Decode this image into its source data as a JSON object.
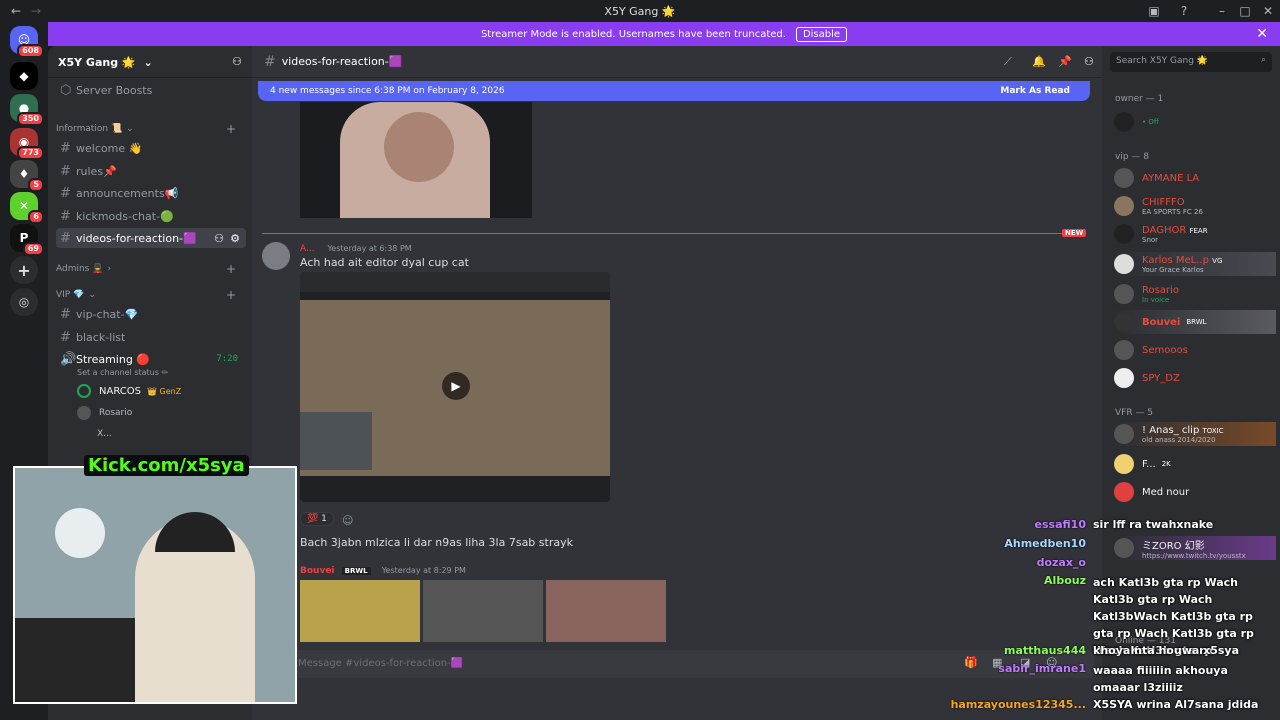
{
  "window": {
    "title": "X5Y Gang 🌟"
  },
  "banner": {
    "text": "Streamer Mode is enabled. Usernames have been truncated.",
    "disable_label": "Disable"
  },
  "rail": {
    "badges": [
      "608",
      "350",
      "773",
      "5",
      "6",
      "69"
    ]
  },
  "guild": {
    "name": "X5Y Gang 🌟",
    "server_boosts": "Server Boosts"
  },
  "sidebar": {
    "categories": {
      "information": "Information 📜",
      "admins": "Admins 💂",
      "vip": "VIP 💎"
    },
    "channels": {
      "welcome": "welcome 👋",
      "rules": "rules📌",
      "announcements": "announcements📢",
      "kickmods": "kickmods-chat-🟢",
      "videos": "videos-for-reaction-🟪",
      "vipchat": "vip-chat-💎",
      "blacklist": "black-list",
      "streaming": "Streaming 🔴"
    },
    "streaming_time": "7:20",
    "channel_status": "Set a channel status ✏",
    "voice_users": [
      "NARCOS",
      "Rosario",
      "X..."
    ],
    "voice_tag": "GenZ"
  },
  "main": {
    "channel_name": "videos-for-reaction-🟪",
    "new_messages": "4 new messages since 6:38 PM on February 8, 2026",
    "mark_as_read": "Mark As Read",
    "new_label": "NEW",
    "msg1": {
      "author": "A...",
      "time": "Yesterday at 6:38 PM",
      "text": "Ach had ait editor dyal cup cat"
    },
    "reaction_count": "1",
    "msg2_text": "Bach 3jabn mlzica li dar n9as liha 3la 7sab strayk",
    "msg3": {
      "author": "Bouvei",
      "tag": "BRWL",
      "time": "Yesterday at 8:29 PM"
    },
    "composer_placeholder": "Message #videos-for-reaction-🟪"
  },
  "members": {
    "search_placeholder": "Search X5Y Gang 🌟",
    "groups": [
      {
        "title": "owner — 1"
      },
      {
        "title": "vip — 8"
      },
      {
        "title": "VFR — 5"
      }
    ],
    "owner": {
      "status": "• Off"
    },
    "vip": [
      {
        "name": "AYMANE LA",
        "sub": "",
        "color": "#e74c3c"
      },
      {
        "name": "CHIFFFO",
        "sub": "EA SPORTS FC 26",
        "color": "#e74c3c"
      },
      {
        "name": "DAGHOR",
        "sub": "Snor",
        "tag": "FEAR",
        "color": "#e74c3c"
      },
      {
        "name": "Karlos MeL..p",
        "sub": "Your Grace Karlos",
        "tag": "VG",
        "color": "#e74c3c"
      },
      {
        "name": "Rosario",
        "sub": "In voice",
        "color": "#e74c3c"
      },
      {
        "name": "Bouvei",
        "sub": "",
        "tag": "BRWL",
        "color": "#e74c3c"
      },
      {
        "name": "Semooos",
        "sub": "",
        "color": "#e74c3c"
      },
      {
        "name": "SPY_DZ",
        "sub": "",
        "color": "#e74c3c"
      }
    ],
    "vfr": [
      {
        "name": "! Anas_ clip",
        "sub": "old anass 2014/2020",
        "tag": "TOXIC",
        "color": "#f2f3f5"
      },
      {
        "name": "F...",
        "sub": "",
        "tag": "2K",
        "color": "#f2f3f5"
      },
      {
        "name": "Med nour",
        "sub": "",
        "color": "#f2f3f5"
      },
      {
        "name": "ミZORO 幻影",
        "sub": "https://www.twitch.tv/yousstx",
        "color": "#f2f3f5"
      }
    ],
    "online_label": "Online — 131"
  },
  "overlay": {
    "kick_label": "Kick.com/x5sya",
    "chat": [
      {
        "user": "essafi10",
        "user_color": "#c17bff",
        "text": "sir lff ra twahxnake"
      },
      {
        "user": "Ahmedben10",
        "user_color": "#a8d7ff",
        "text": ""
      },
      {
        "user": "dozax_o",
        "user_color": "#c17bff",
        "text": ""
      },
      {
        "user": "Albouz",
        "user_color": "#8dfa5a",
        "text": "ach Katl3b gta rp Wach Katl3b gta rp Wach Katl3bWach Katl3b gta rp gta rp Wach Katl3b gta rp Wach Katl3b gta rp"
      },
      {
        "user": "matthaus444",
        "user_color": "#8dfa5a",
        "text": "khoya nta houwa x5sya"
      },
      {
        "user": "sabir_imrane1",
        "user_color": "#c17bff",
        "text": "waaaa fiiiiiin akhouya omaaar l3ziiiiz"
      },
      {
        "user": "hamzayounes12345...",
        "user_color": "#f5a623",
        "text": "X5SYA wrina Al7sana jdida"
      }
    ]
  }
}
